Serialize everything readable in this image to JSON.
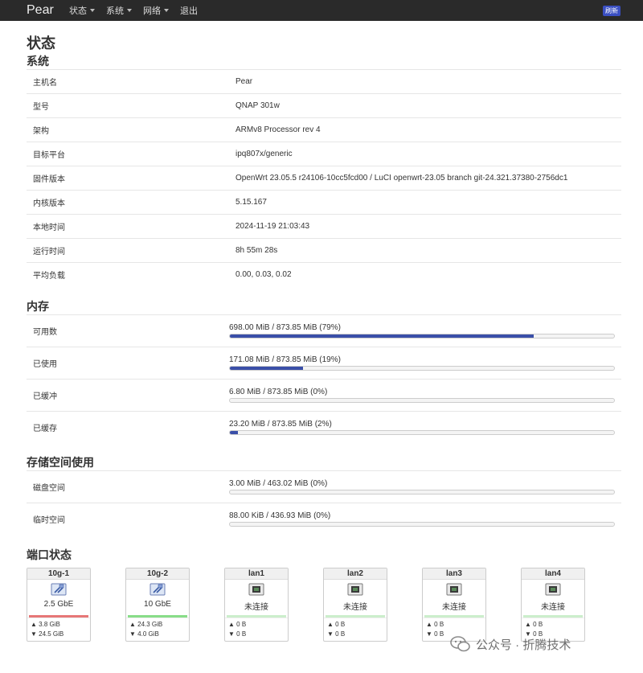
{
  "nav": {
    "brand": "Pear",
    "menu": [
      {
        "label": "状态",
        "has_dropdown": true
      },
      {
        "label": "系统",
        "has_dropdown": true
      },
      {
        "label": "网络",
        "has_dropdown": true
      },
      {
        "label": "退出",
        "has_dropdown": false
      }
    ],
    "refresh_label": "刷新"
  },
  "page_title": "状态",
  "system": {
    "title": "系统",
    "rows": [
      {
        "key": "主机名",
        "value": "Pear"
      },
      {
        "key": "型号",
        "value": "QNAP 301w"
      },
      {
        "key": "架构",
        "value": "ARMv8 Processor rev 4"
      },
      {
        "key": "目标平台",
        "value": "ipq807x/generic"
      },
      {
        "key": "固件版本",
        "value": "OpenWrt 23.05.5 r24106-10cc5fcd00 / LuCI openwrt-23.05 branch git-24.321.37380-2756dc1"
      },
      {
        "key": "内核版本",
        "value": "5.15.167"
      },
      {
        "key": "本地时间",
        "value": "2024-11-19 21:03:43"
      },
      {
        "key": "运行时间",
        "value": "8h 55m 28s"
      },
      {
        "key": "平均负载",
        "value": "0.00, 0.03, 0.02"
      }
    ]
  },
  "memory": {
    "title": "内存",
    "rows": [
      {
        "key": "可用数",
        "text": "698.00 MiB / 873.85 MiB (79%)",
        "percent": 79
      },
      {
        "key": "已使用",
        "text": "171.08 MiB / 873.85 MiB (19%)",
        "percent": 19
      },
      {
        "key": "已缓冲",
        "text": "6.80 MiB / 873.85 MiB (0%)",
        "percent": 0
      },
      {
        "key": "已缓存",
        "text": "23.20 MiB / 873.85 MiB (2%)",
        "percent": 2
      }
    ]
  },
  "storage": {
    "title": "存储空间使用",
    "rows": [
      {
        "key": "磁盘空间",
        "text": "3.00 MiB / 463.02 MiB (0%)",
        "percent": 0
      },
      {
        "key": "临时空间",
        "text": "88.00 KiB / 436.93 MiB (0%)",
        "percent": 0
      }
    ]
  },
  "ports": {
    "title": "端口状态",
    "items": [
      {
        "name": "10g-1",
        "status": "2.5 GbE",
        "connected": true,
        "line_color": "#e77777",
        "tx": "▲ 3.8 GiB",
        "rx": "▼ 24.5 GiB"
      },
      {
        "name": "10g-2",
        "status": "10 GbE",
        "connected": true,
        "line_color": "#88dd88",
        "tx": "▲ 24.3 GiB",
        "rx": "▼ 4.0 GiB"
      },
      {
        "name": "lan1",
        "status": "未连接",
        "connected": false,
        "line_color": "#cceecc",
        "tx": "▲ 0 B",
        "rx": "▼ 0 B"
      },
      {
        "name": "lan2",
        "status": "未连接",
        "connected": false,
        "line_color": "#cceecc",
        "tx": "▲ 0 B",
        "rx": "▼ 0 B"
      },
      {
        "name": "lan3",
        "status": "未连接",
        "connected": false,
        "line_color": "#cceecc",
        "tx": "▲ 0 B",
        "rx": "▼ 0 B"
      },
      {
        "name": "lan4",
        "status": "未连接",
        "connected": false,
        "line_color": "#cceecc",
        "tx": "▲ 0 B",
        "rx": "▼ 0 B"
      }
    ]
  },
  "watermark": {
    "text": "公众号 · 折腾技术",
    "icon": "wechat-icon"
  },
  "colors": {
    "accent": "#3a4fa8",
    "navbar": "#2a2a2a"
  }
}
